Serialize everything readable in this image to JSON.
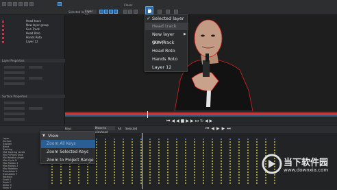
{
  "toolbar": {
    "selected_layer_label": "Selected layer",
    "layer_dropdown": "Layer 12",
    "closer_label": "Closer"
  },
  "tracks_panel": {
    "tracks": [
      {
        "name": "Head track"
      },
      {
        "name": "New layer group"
      },
      {
        "name": "Gun Track"
      },
      {
        "name": "Head Roto"
      },
      {
        "name": "Hands Roto"
      },
      {
        "name": "Layer 12"
      }
    ],
    "section_properties": "Layer Properties",
    "section_surface": "Surface Properties"
  },
  "layer_menu": {
    "items": [
      {
        "label": "Selected layer",
        "checked": true,
        "highlighted": false,
        "submenu": false
      },
      {
        "label": "Head track",
        "checked": false,
        "highlighted": true,
        "submenu": false
      },
      {
        "label": "New layer group",
        "checked": false,
        "highlighted": false,
        "submenu": true
      },
      {
        "label": "Gun Track",
        "checked": false,
        "highlighted": false,
        "submenu": false
      },
      {
        "label": "Head Roto",
        "checked": false,
        "highlighted": false,
        "submenu": false
      },
      {
        "label": "Hands Roto",
        "checked": false,
        "highlighted": false,
        "submenu": false
      },
      {
        "label": "Layer 12",
        "checked": false,
        "highlighted": false,
        "submenu": false
      }
    ]
  },
  "keyframe_bar": {
    "all_keys": "Keys",
    "move_to_playhead": "Move to playhead",
    "all": "All",
    "selected": "Selected"
  },
  "view_menu": {
    "header": "View",
    "items": [
      {
        "label": "Zoom All Keys",
        "highlighted": true
      },
      {
        "label": "Zoom Selected Keys",
        "highlighted": false
      },
      {
        "label": "Zoom to Project Range",
        "highlighted": false
      }
    ]
  },
  "dopesheet": {
    "rows": [
      "Layer",
      "Surface",
      "Tracked",
      "Blend",
      "Tracking",
      "Mat Tracking Levels",
      "Min Pt Pixels Used",
      "Min Relative Angle",
      "Max Cycle %",
      "Max Motion 1",
      "Max Motion 2",
      "Max Rotation",
      "Translation X",
      "Translation Y",
      "Rotation",
      "Scale X",
      "Scale Y",
      "Shear X",
      "Shear Y"
    ]
  },
  "watermark": {
    "title": "当下软件园",
    "url": "www.downxia.com"
  },
  "colors": {
    "accent": "#2f6ea8",
    "keyframe": "#cfc33a",
    "track_square": "#dd3333",
    "matte_outline": "#e03030"
  }
}
